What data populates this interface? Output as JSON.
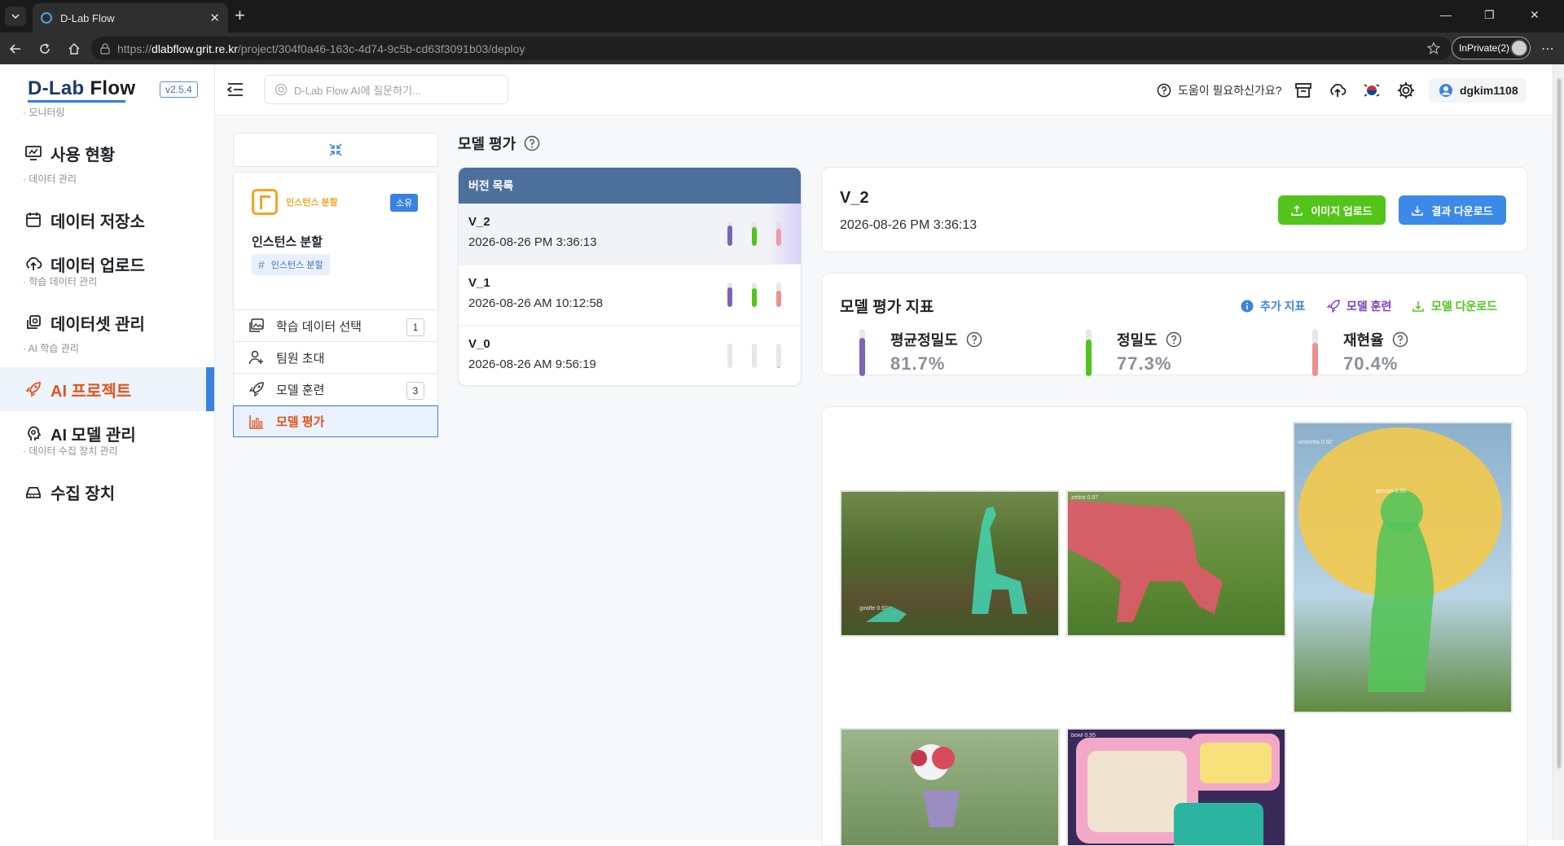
{
  "browser": {
    "tab_title": "D-Lab Flow",
    "url_prefix": "https://",
    "url_host": "dlabflow.grit.re.kr",
    "url_path": "/project/304f0a46-163c-4d74-9c5b-cd63f3091b03/deploy",
    "inprivate_label": "InPrivate(2)"
  },
  "sidebar": {
    "logo_main": "D-Lab",
    "logo_flow": "Flow",
    "version": "v2.5.4",
    "sections": {
      "monitoring": "· 모니터링",
      "data": "· 데이터 관리",
      "training_data": "· 학습 데이터 관리",
      "ai": "· AI 학습 관리",
      "devices": "· 데이터 수집 장치 관리"
    },
    "items": [
      {
        "label": "사용 현황",
        "icon": "monitor-chart-icon"
      },
      {
        "label": "데이터 저장소",
        "icon": "calendar-icon"
      },
      {
        "label": "데이터 업로드",
        "icon": "cloud-upload-icon"
      },
      {
        "label": "데이터셋 관리",
        "icon": "dataset-icon"
      },
      {
        "label": "AI 프로젝트",
        "icon": "rocket-icon"
      },
      {
        "label": "AI 모델 관리",
        "icon": "brain-icon"
      },
      {
        "label": "수집 장치",
        "icon": "device-icon"
      }
    ]
  },
  "header": {
    "ask_placeholder": "D-Lab Flow AI에 질문하기...",
    "help": "도움이 필요하신가요?",
    "username": "dgkim1108"
  },
  "project": {
    "type": "인스턴스 분할",
    "badge": "소유",
    "name": "인스턴스 분할",
    "tag": "인스턴스 분할",
    "steps": [
      {
        "label": "학습 데이터 선택",
        "count": "1"
      },
      {
        "label": "팀원 초대",
        "count": ""
      },
      {
        "label": "모델 훈련",
        "count": "3"
      },
      {
        "label": "모델 평가",
        "count": ""
      }
    ]
  },
  "evaluation": {
    "title": "모델 평가",
    "list_header": "버전 목록",
    "versions": [
      {
        "name": "V_2",
        "date": "2026-08-26 PM 3:36:13",
        "bars": [
          0.82,
          0.77,
          0.7
        ]
      },
      {
        "name": "V_1",
        "date": "2026-08-26 AM 10:12:58",
        "bars": [
          0.8,
          0.76,
          0.68
        ]
      },
      {
        "name": "V_0",
        "date": "2026-08-26 AM 9:56:19",
        "bars": [
          0,
          0,
          0.05
        ]
      }
    ],
    "selected": {
      "name": "V_2",
      "date": "2026-08-26 PM 3:36:13",
      "upload_label": "이미지 업로드",
      "download_label": "결과 다운로드"
    },
    "metrics_title": "모델 평가 지표",
    "actions": {
      "extra": "추가 지표",
      "train": "모델 훈련",
      "download": "모델 다운로드"
    },
    "metrics": [
      {
        "label": "평균정밀도",
        "value": "81.7%",
        "fraction": 0.817,
        "color": "#7a63b8"
      },
      {
        "label": "정밀도",
        "value": "77.3%",
        "fraction": 0.773,
        "color": "#52c41a"
      },
      {
        "label": "재현율",
        "value": "70.4%",
        "fraction": 0.704,
        "color": "#ef8f8f"
      }
    ],
    "gallery_labels": {
      "giraffe": "giraffe 0.97",
      "umbrella": "umbrella 0.92",
      "person": "person 0.96",
      "zebra": "zebra 0.97",
      "bowl": "bowl 0.95"
    }
  },
  "colors": {
    "accent": "#3b82e0",
    "active_text": "#e0531f",
    "upload_btn": "#52c41a",
    "download_btn": "#3b8ae8",
    "list_header": "#4d6f9c"
  }
}
